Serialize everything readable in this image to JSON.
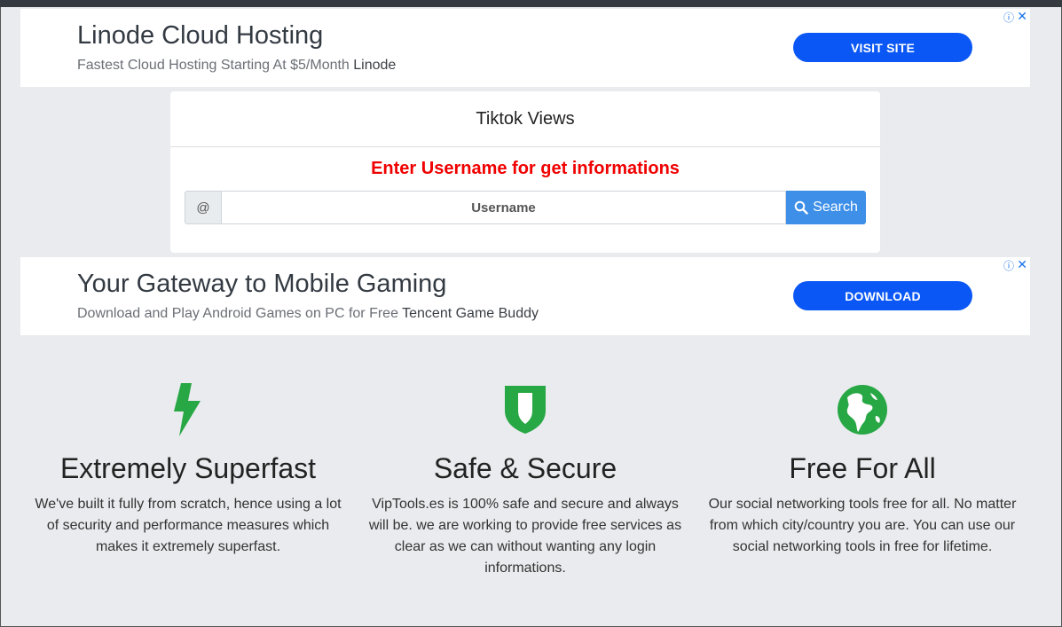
{
  "ads": [
    {
      "title": "Linode Cloud Hosting",
      "subtitle": "Fastest Cloud Hosting Starting At $5/Month",
      "advertiser": "Linode",
      "button": "VISIT SITE",
      "info_icon": "ⓘ",
      "close_icon": "✕"
    },
    {
      "title": "Your Gateway to Mobile Gaming",
      "subtitle": "Download and Play Android Games on PC for Free",
      "advertiser": "Tencent Game Buddy",
      "button": "DOWNLOAD",
      "info_icon": "ⓘ",
      "close_icon": "✕"
    }
  ],
  "form": {
    "title": "Tiktok Views",
    "prompt": "Enter Username for get informations",
    "addon": "@",
    "placeholder": "Username",
    "search_label": "Search",
    "prompt_color": "#f00000",
    "button_color": "#3d8fe8"
  },
  "features": [
    {
      "icon": "lightning-bolt-icon",
      "title": "Extremely Superfast",
      "desc": "We've built it fully from scratch, hence using a lot of security and performance measures which makes it extremely superfast."
    },
    {
      "icon": "shield-icon",
      "title": "Safe & Secure",
      "desc": "VipTools.es is 100% safe and secure and always will be. we are working to provide free services as clear as we can without wanting any login informations."
    },
    {
      "icon": "globe-icon",
      "title": "Free For All",
      "desc": "Our social networking tools free for all. No matter from which city/country you are. You can use our social networking tools in free for lifetime."
    }
  ],
  "colors": {
    "accent_green": "#28a745",
    "ad_button": "#0a57f5"
  }
}
